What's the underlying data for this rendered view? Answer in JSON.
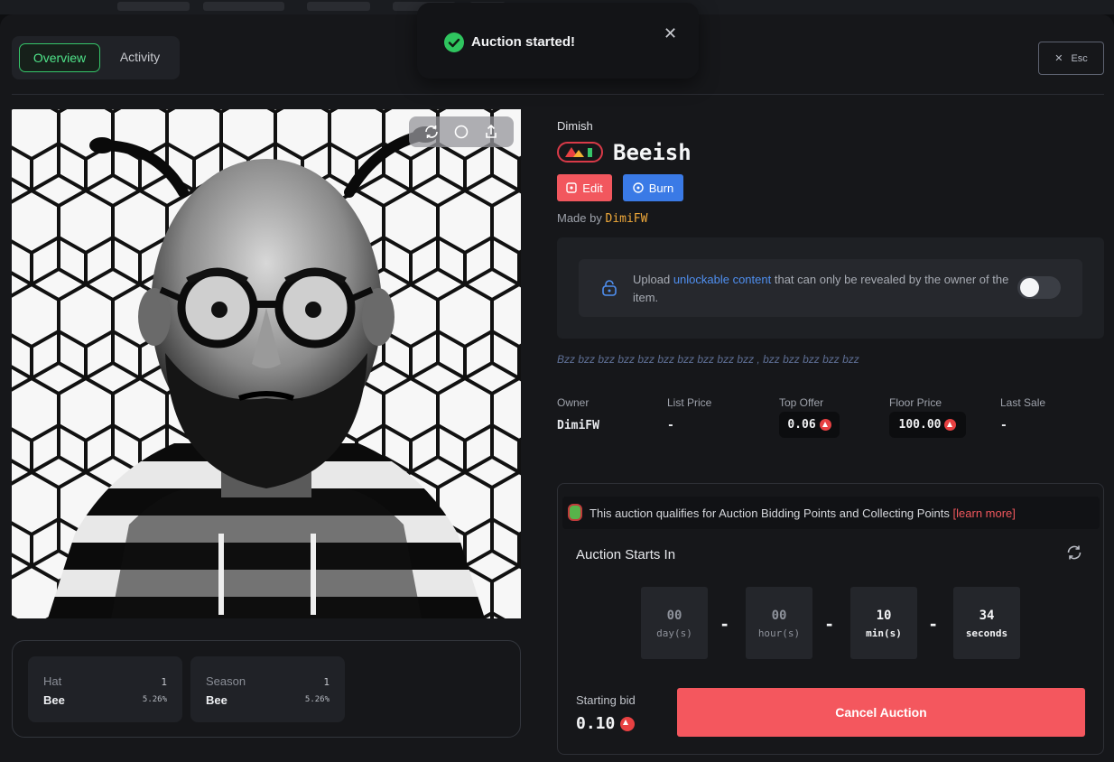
{
  "toast": {
    "message": "Auction started!"
  },
  "tabs": [
    {
      "label": "Overview",
      "active": true
    },
    {
      "label": "Activity",
      "active": false
    }
  ],
  "esc_label": "Esc",
  "item": {
    "collection": "Dimish",
    "title": "Beeish",
    "edit_label": "Edit",
    "burn_label": "Burn",
    "made_by_prefix": "Made by",
    "creator": "DimiFW",
    "description": "Bzz bzz bzz bzz bzz bzz bzz bzz bzz bzz , bzz bzz bzz bzz bzz"
  },
  "unlockable": {
    "prefix": "Upload ",
    "link": "unlockable content",
    "suffix": " that can only be revealed by the owner of the item.",
    "enabled": false
  },
  "stats": {
    "owner": {
      "label": "Owner",
      "value": "DimiFW"
    },
    "list_price": {
      "label": "List Price",
      "value": "-"
    },
    "top_offer": {
      "label": "Top Offer",
      "value": "0.06"
    },
    "floor_price": {
      "label": "Floor Price",
      "value": "100.00"
    },
    "last_sale": {
      "label": "Last Sale",
      "value": "-"
    }
  },
  "traits": [
    {
      "type": "Hat",
      "value": "Bee",
      "count": "1",
      "percent": "5.26%"
    },
    {
      "type": "Season",
      "value": "Bee",
      "count": "1",
      "percent": "5.26%"
    }
  ],
  "auction": {
    "points_text": "This auction qualifies for Auction Bidding Points and Collecting Points",
    "learn_more": "[learn more]",
    "heading": "Auction Starts In",
    "countdown": [
      {
        "value": "00",
        "unit": "day(s)"
      },
      {
        "value": "00",
        "unit": "hour(s)"
      },
      {
        "value": "10",
        "unit": "min(s)"
      },
      {
        "value": "34",
        "unit": "seconds"
      }
    ],
    "separator": "-",
    "starting_bid_label": "Starting bid",
    "starting_bid_value": "0.10",
    "cancel_label": "Cancel Auction"
  },
  "colors": {
    "accent_green": "#36c66a",
    "danger": "#f4575e",
    "primary_blue": "#3a7ae6",
    "creator_orange": "#f0a93a",
    "link_blue": "#4f8ff0",
    "avax_red": "#e84142"
  }
}
